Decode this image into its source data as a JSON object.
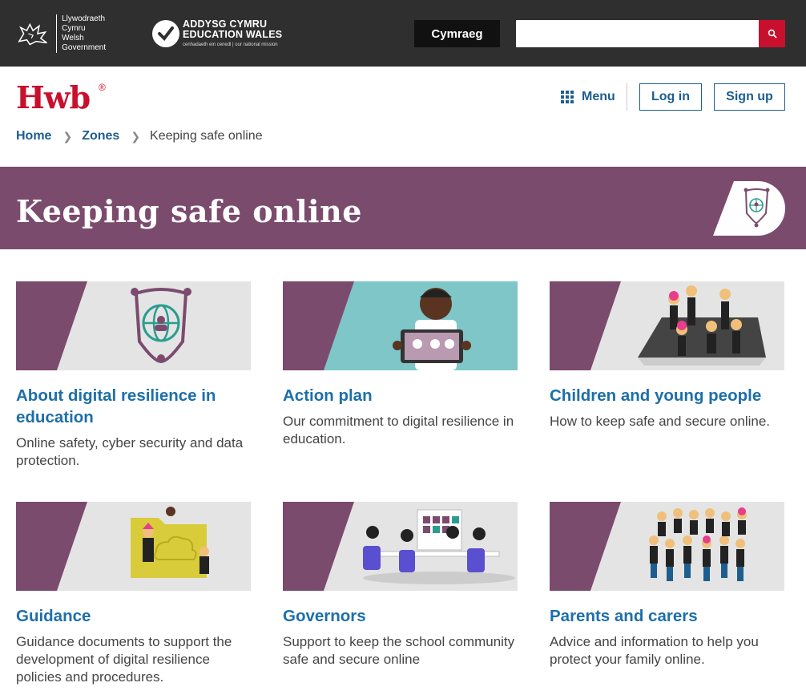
{
  "topbar": {
    "wg_line1": "Llywodraeth Cymru",
    "wg_line2": "Welsh Government",
    "ew_line1": "ADDYSG CYMRU",
    "ew_line2": "EDUCATION WALES",
    "ew_tagline": "cenhadaeth ein cenedl | our national mission",
    "language_label": "Cymraeg",
    "search_placeholder": ""
  },
  "header": {
    "logo_text": "Hwb",
    "logo_reg": "®",
    "menu_label": "Menu",
    "login_label": "Log in",
    "signup_label": "Sign up"
  },
  "breadcrumb": {
    "items": [
      "Home",
      "Zones"
    ],
    "current": "Keeping safe online"
  },
  "banner": {
    "title": "Keeping safe online"
  },
  "colors": {
    "topbar": "#2f2f2f",
    "brand_red": "#c8102e",
    "link_blue": "#1d6fa8",
    "banner_purple": "#7b4b6e",
    "teal": "#2a9d8f"
  },
  "cards": [
    {
      "title": "About digital resilience in education",
      "desc": "Online safety, cyber security and data protection.",
      "image": "shield-globe-icon"
    },
    {
      "title": "Action plan",
      "desc": "Our commitment to digital resilience in education.",
      "image": "person-with-tablet"
    },
    {
      "title": "Children and young people",
      "desc": "How to keep safe and secure online.",
      "image": "young-people-group"
    },
    {
      "title": "Guidance",
      "desc": "Guidance documents to support the development of digital resilience policies and procedures.",
      "image": "folder-cloud"
    },
    {
      "title": "Governors",
      "desc": "Support to keep the school community safe and secure online",
      "image": "meeting-table"
    },
    {
      "title": "Parents and carers",
      "desc": "Advice and information to help you protect your family online.",
      "image": "family-group"
    }
  ]
}
